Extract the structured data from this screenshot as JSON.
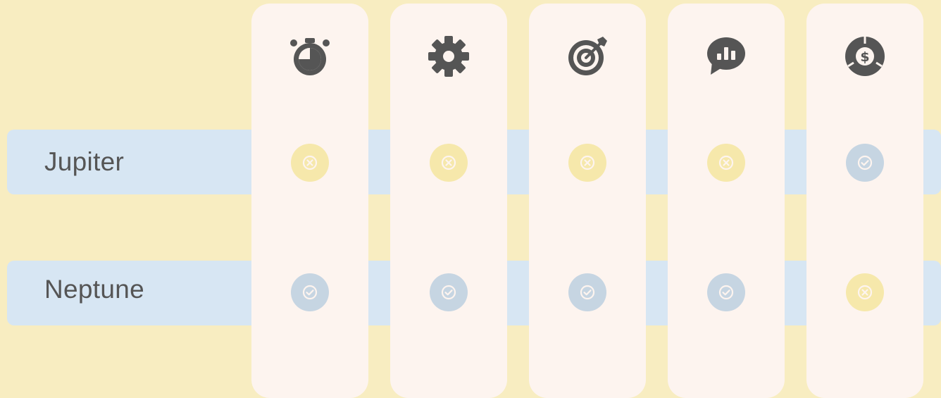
{
  "colors": {
    "background": "#f8edc1",
    "row_band": "#d7e6f3",
    "column_card": "#fdf4ef",
    "icon": "#555555",
    "no_mark": "#f6e8ab",
    "yes_mark": "#c6d5e2"
  },
  "columns": [
    {
      "icon": "stopwatch-icon"
    },
    {
      "icon": "gear-icon"
    },
    {
      "icon": "target-arrow-icon"
    },
    {
      "icon": "chat-chart-icon"
    },
    {
      "icon": "money-cycle-icon"
    }
  ],
  "rows": [
    {
      "label": "Jupiter",
      "values": [
        "no",
        "no",
        "no",
        "no",
        "yes"
      ]
    },
    {
      "label": "Neptune",
      "values": [
        "yes",
        "yes",
        "yes",
        "yes",
        "no"
      ]
    }
  ]
}
